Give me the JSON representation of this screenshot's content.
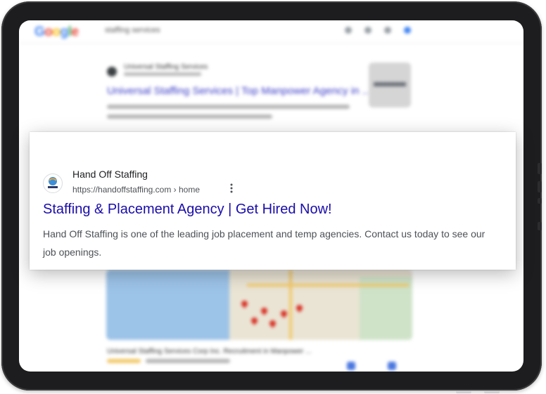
{
  "search_header": {
    "logo": [
      "G",
      "o",
      "o",
      "g",
      "l",
      "e"
    ],
    "query": "staffing services"
  },
  "background_result_top": {
    "site_name": "Universal Staffing Services",
    "title": "Universal Staffing Services | Top Manpower Agency in ..."
  },
  "background_result_bottom": {
    "title": "Universal Staffing Services Corp Inc. Recruitment in Manpower ..."
  },
  "featured_result": {
    "site_name": "Hand Off Staffing",
    "url": "https://handoffstaffing.com › home",
    "menu_icon": "more-vert-icon",
    "title": "Staffing & Placement Agency | Get Hired Now!",
    "snippet": "Hand Off Staffing is one of the leading job placement and temp agencies. Contact us today to see our job openings."
  },
  "colors": {
    "link_blue": "#1a0dab",
    "snippet_gray": "#4d5156",
    "frame": "#1d1d1f"
  }
}
